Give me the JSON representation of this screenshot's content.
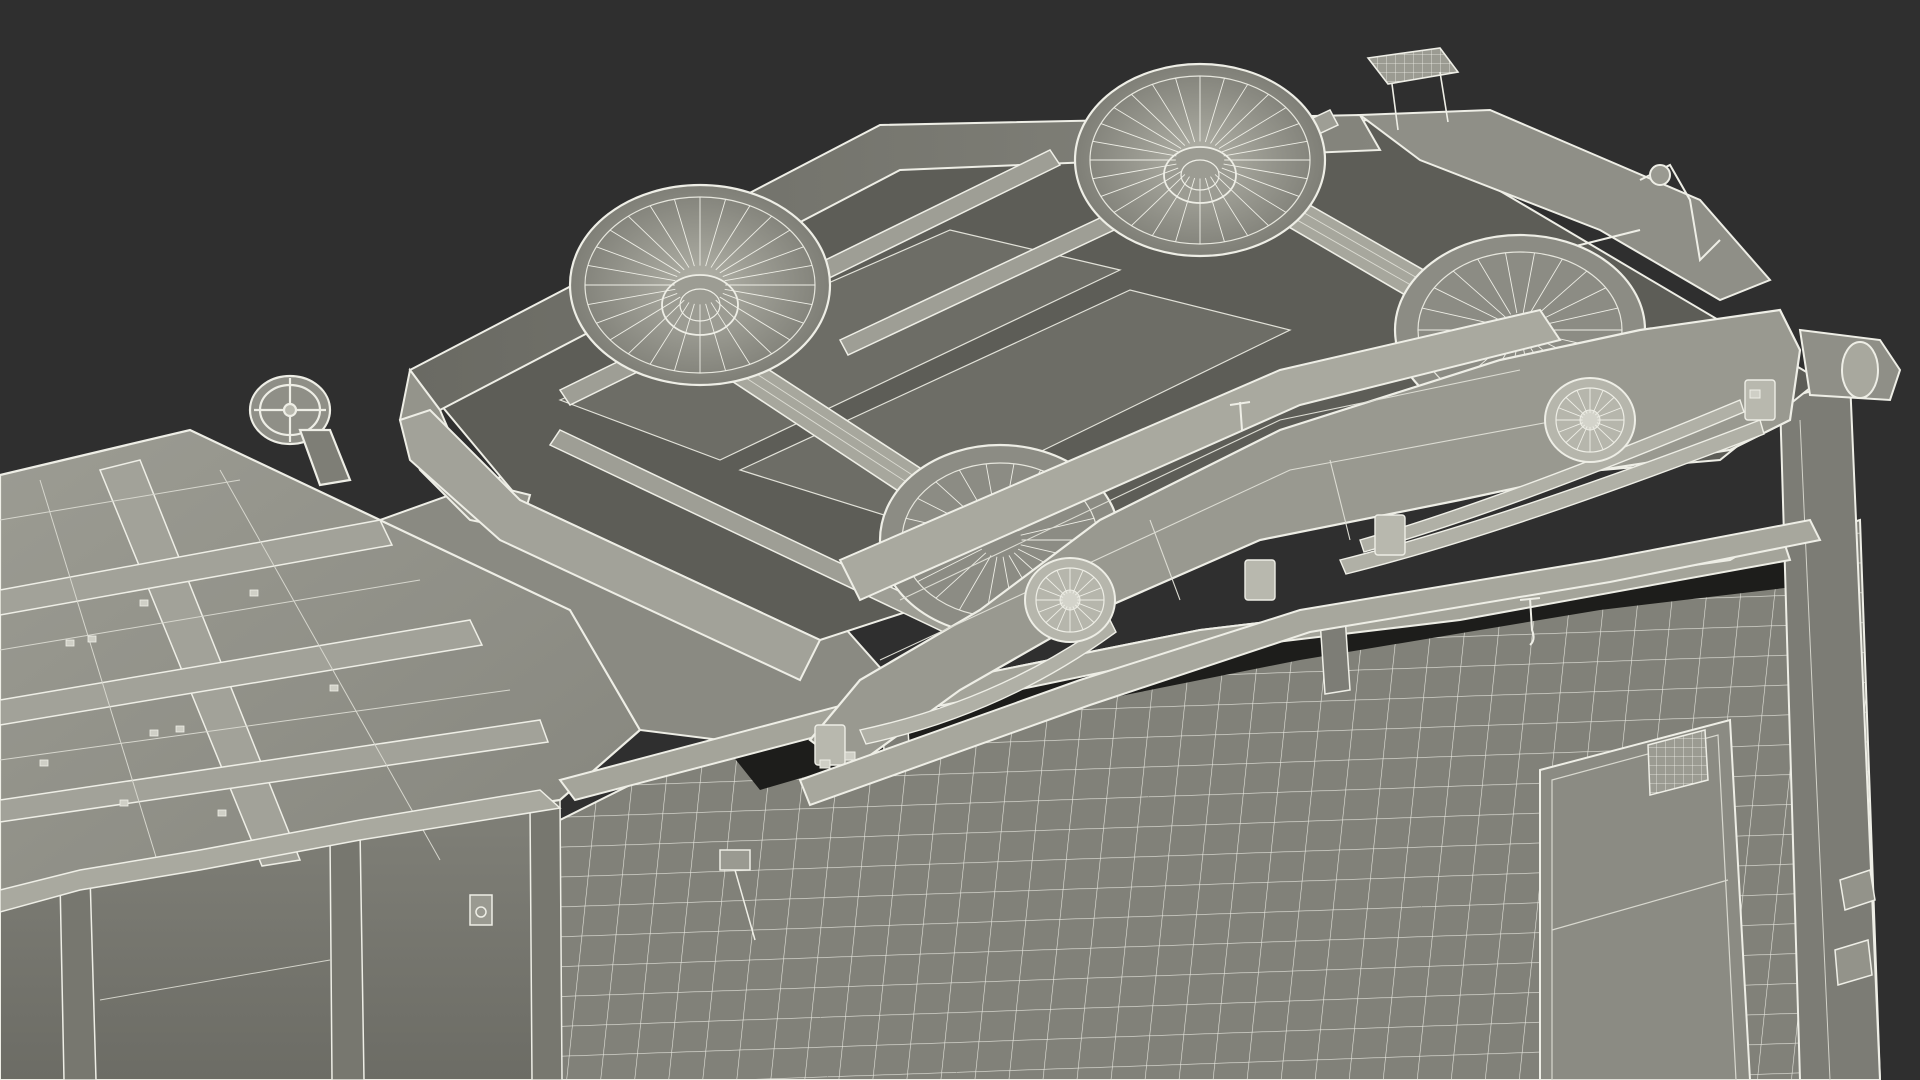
{
  "scene": {
    "subject": "3d-wireframe-rail-car",
    "view": "overturned-freight-car-underside-with-bogie",
    "colors": {
      "background": "#2f2f2f",
      "surface": "#8e8e86",
      "surface_light": "#a6a69c",
      "surface_dark": "#5f5f58",
      "shadow": "#3b3b37",
      "wire": "#eeeee6",
      "wire_dim": "#cfcfc6"
    }
  }
}
